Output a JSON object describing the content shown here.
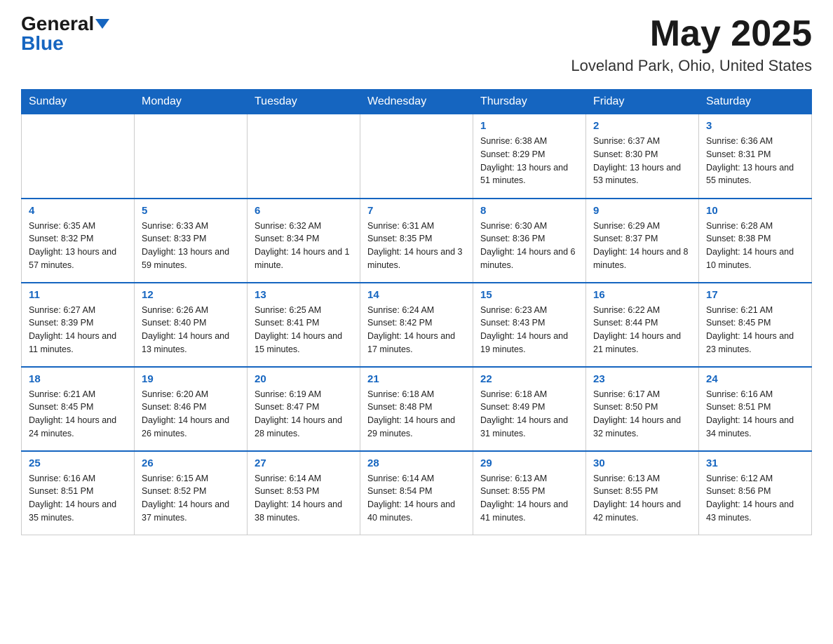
{
  "header": {
    "logo_general": "General",
    "logo_blue": "Blue",
    "month": "May 2025",
    "location": "Loveland Park, Ohio, United States"
  },
  "days_of_week": [
    "Sunday",
    "Monday",
    "Tuesday",
    "Wednesday",
    "Thursday",
    "Friday",
    "Saturday"
  ],
  "weeks": [
    [
      {
        "day": "",
        "info": ""
      },
      {
        "day": "",
        "info": ""
      },
      {
        "day": "",
        "info": ""
      },
      {
        "day": "",
        "info": ""
      },
      {
        "day": "1",
        "info": "Sunrise: 6:38 AM\nSunset: 8:29 PM\nDaylight: 13 hours and 51 minutes."
      },
      {
        "day": "2",
        "info": "Sunrise: 6:37 AM\nSunset: 8:30 PM\nDaylight: 13 hours and 53 minutes."
      },
      {
        "day": "3",
        "info": "Sunrise: 6:36 AM\nSunset: 8:31 PM\nDaylight: 13 hours and 55 minutes."
      }
    ],
    [
      {
        "day": "4",
        "info": "Sunrise: 6:35 AM\nSunset: 8:32 PM\nDaylight: 13 hours and 57 minutes."
      },
      {
        "day": "5",
        "info": "Sunrise: 6:33 AM\nSunset: 8:33 PM\nDaylight: 13 hours and 59 minutes."
      },
      {
        "day": "6",
        "info": "Sunrise: 6:32 AM\nSunset: 8:34 PM\nDaylight: 14 hours and 1 minute."
      },
      {
        "day": "7",
        "info": "Sunrise: 6:31 AM\nSunset: 8:35 PM\nDaylight: 14 hours and 3 minutes."
      },
      {
        "day": "8",
        "info": "Sunrise: 6:30 AM\nSunset: 8:36 PM\nDaylight: 14 hours and 6 minutes."
      },
      {
        "day": "9",
        "info": "Sunrise: 6:29 AM\nSunset: 8:37 PM\nDaylight: 14 hours and 8 minutes."
      },
      {
        "day": "10",
        "info": "Sunrise: 6:28 AM\nSunset: 8:38 PM\nDaylight: 14 hours and 10 minutes."
      }
    ],
    [
      {
        "day": "11",
        "info": "Sunrise: 6:27 AM\nSunset: 8:39 PM\nDaylight: 14 hours and 11 minutes."
      },
      {
        "day": "12",
        "info": "Sunrise: 6:26 AM\nSunset: 8:40 PM\nDaylight: 14 hours and 13 minutes."
      },
      {
        "day": "13",
        "info": "Sunrise: 6:25 AM\nSunset: 8:41 PM\nDaylight: 14 hours and 15 minutes."
      },
      {
        "day": "14",
        "info": "Sunrise: 6:24 AM\nSunset: 8:42 PM\nDaylight: 14 hours and 17 minutes."
      },
      {
        "day": "15",
        "info": "Sunrise: 6:23 AM\nSunset: 8:43 PM\nDaylight: 14 hours and 19 minutes."
      },
      {
        "day": "16",
        "info": "Sunrise: 6:22 AM\nSunset: 8:44 PM\nDaylight: 14 hours and 21 minutes."
      },
      {
        "day": "17",
        "info": "Sunrise: 6:21 AM\nSunset: 8:45 PM\nDaylight: 14 hours and 23 minutes."
      }
    ],
    [
      {
        "day": "18",
        "info": "Sunrise: 6:21 AM\nSunset: 8:45 PM\nDaylight: 14 hours and 24 minutes."
      },
      {
        "day": "19",
        "info": "Sunrise: 6:20 AM\nSunset: 8:46 PM\nDaylight: 14 hours and 26 minutes."
      },
      {
        "day": "20",
        "info": "Sunrise: 6:19 AM\nSunset: 8:47 PM\nDaylight: 14 hours and 28 minutes."
      },
      {
        "day": "21",
        "info": "Sunrise: 6:18 AM\nSunset: 8:48 PM\nDaylight: 14 hours and 29 minutes."
      },
      {
        "day": "22",
        "info": "Sunrise: 6:18 AM\nSunset: 8:49 PM\nDaylight: 14 hours and 31 minutes."
      },
      {
        "day": "23",
        "info": "Sunrise: 6:17 AM\nSunset: 8:50 PM\nDaylight: 14 hours and 32 minutes."
      },
      {
        "day": "24",
        "info": "Sunrise: 6:16 AM\nSunset: 8:51 PM\nDaylight: 14 hours and 34 minutes."
      }
    ],
    [
      {
        "day": "25",
        "info": "Sunrise: 6:16 AM\nSunset: 8:51 PM\nDaylight: 14 hours and 35 minutes."
      },
      {
        "day": "26",
        "info": "Sunrise: 6:15 AM\nSunset: 8:52 PM\nDaylight: 14 hours and 37 minutes."
      },
      {
        "day": "27",
        "info": "Sunrise: 6:14 AM\nSunset: 8:53 PM\nDaylight: 14 hours and 38 minutes."
      },
      {
        "day": "28",
        "info": "Sunrise: 6:14 AM\nSunset: 8:54 PM\nDaylight: 14 hours and 40 minutes."
      },
      {
        "day": "29",
        "info": "Sunrise: 6:13 AM\nSunset: 8:55 PM\nDaylight: 14 hours and 41 minutes."
      },
      {
        "day": "30",
        "info": "Sunrise: 6:13 AM\nSunset: 8:55 PM\nDaylight: 14 hours and 42 minutes."
      },
      {
        "day": "31",
        "info": "Sunrise: 6:12 AM\nSunset: 8:56 PM\nDaylight: 14 hours and 43 minutes."
      }
    ]
  ]
}
